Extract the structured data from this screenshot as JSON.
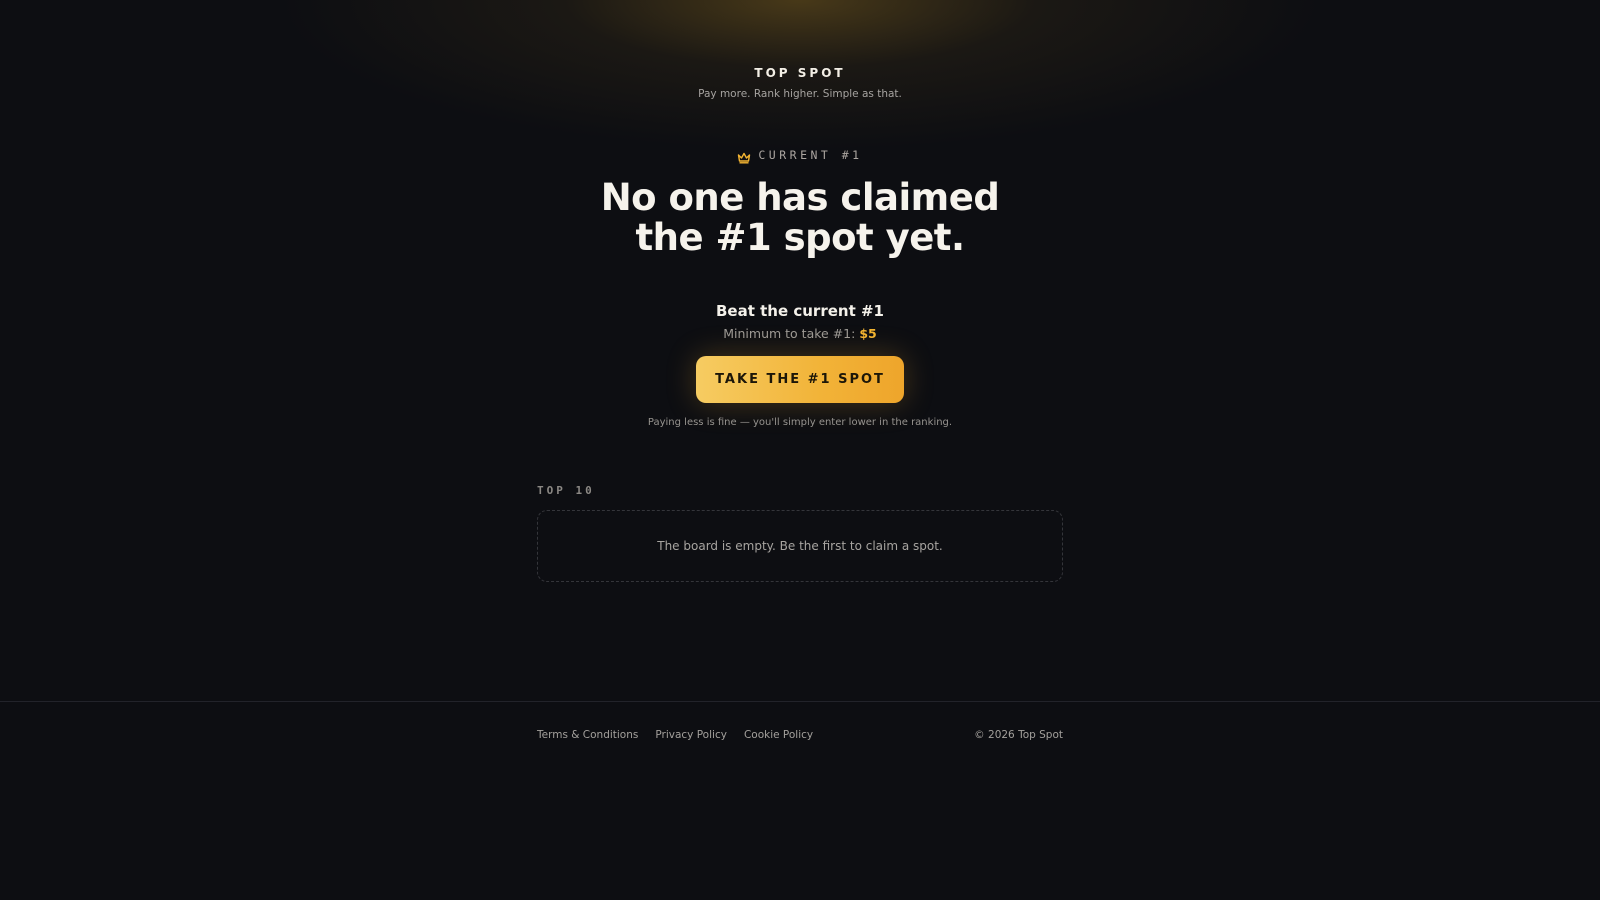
{
  "header": {
    "title": "TOP SPOT",
    "tagline": "Pay more. Rank higher. Simple as that."
  },
  "current": {
    "icon": "crown-icon",
    "label": "CURRENT #1",
    "headline_line1": "No one has claimed",
    "headline_line2": "the #1 spot yet."
  },
  "offer": {
    "heading": "Beat the current #1",
    "minimum_prefix": "Minimum to take #1:",
    "minimum_amount": "$5",
    "cta_label": "TAKE THE #1 SPOT",
    "note": "Paying less is fine — you'll simply enter lower in the ranking."
  },
  "leaderboard": {
    "label": "TOP 10",
    "empty_message": "The board is empty. Be the first to claim a spot."
  },
  "footer": {
    "links": [
      {
        "label": "Terms & Conditions"
      },
      {
        "label": "Privacy Policy"
      },
      {
        "label": "Cookie Policy"
      }
    ],
    "copyright": "© 2026 Top Spot"
  },
  "colors": {
    "background": "#0d0e12",
    "accent": "#f3b431",
    "button_gradient_start": "#f6cc62",
    "button_gradient_end": "#eea52b"
  }
}
